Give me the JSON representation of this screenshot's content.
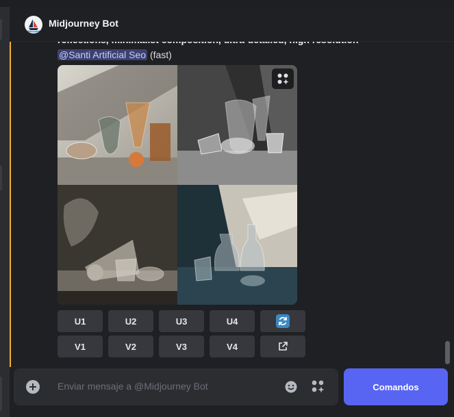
{
  "header": {
    "title": "Midjourney Bot",
    "avatar_icon": "midjourney-sailboat-icon"
  },
  "message": {
    "prompt_tail": "reflections, minimalist composition, ultra-detailed, high resolution",
    "mention": "@Santi Artificial Seo",
    "mode": "(fast)",
    "image_grid_icon": "apps-sparkle-icon"
  },
  "buttons": {
    "row1": [
      "U1",
      "U2",
      "U3",
      "U4"
    ],
    "row2": [
      "V1",
      "V2",
      "V3",
      "V4"
    ],
    "reroll_icon": "refresh-icon",
    "open_icon": "external-link-icon"
  },
  "composer": {
    "placeholder": "Enviar mensaje a @Midjourney Bot",
    "plus_icon": "add-circle-icon",
    "emoji_icon": "emoji-icon",
    "apps_icon": "apps-sparkle-icon"
  },
  "commands_button": "Comandos",
  "colors": {
    "accent": "#5865f2",
    "mention_bg": "#3c4270",
    "highlight_line": "#f0b232"
  }
}
